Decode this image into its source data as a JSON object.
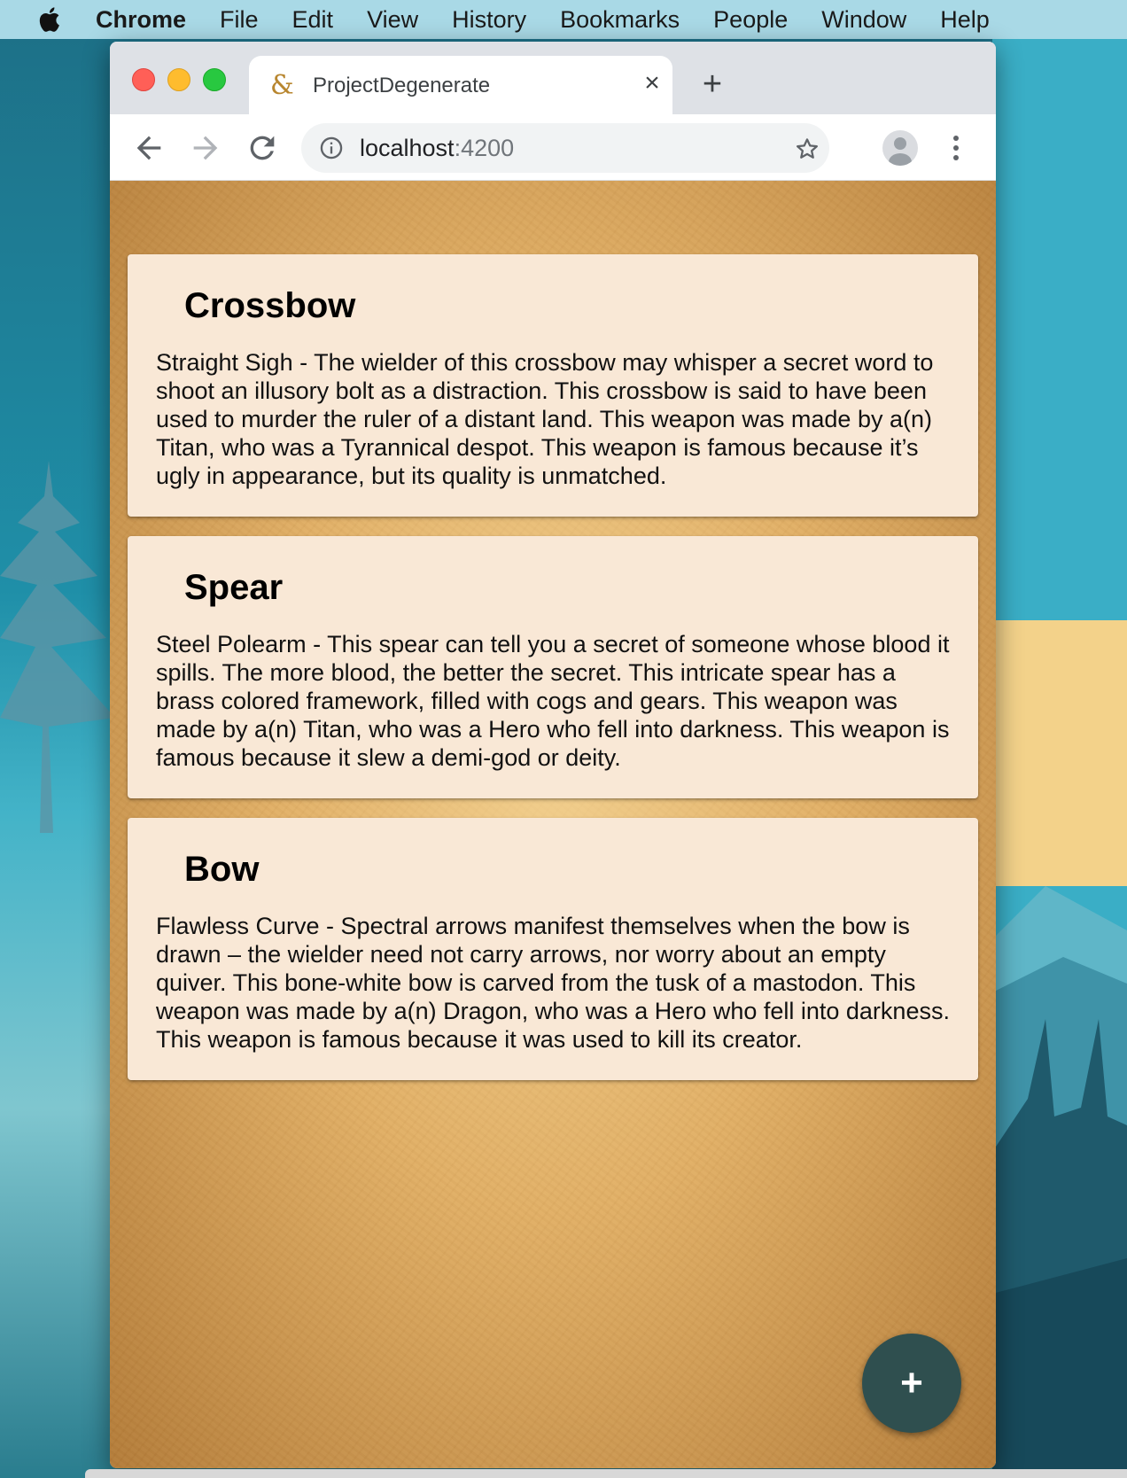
{
  "menubar": {
    "app": "Chrome",
    "items": [
      "File",
      "Edit",
      "View",
      "History",
      "Bookmarks",
      "People",
      "Window",
      "Help"
    ]
  },
  "browser": {
    "tab_title": "ProjectDegenerate",
    "tab_favicon": "&",
    "tab_close": "×",
    "new_tab": "+",
    "url_host": "localhost",
    "url_port": ":4200"
  },
  "cards": [
    {
      "title": "Crossbow",
      "text": "Straight Sigh - The wielder of this crossbow may whisper a secret word to shoot an illusory bolt as a distraction. This crossbow is said to have been used to murder the ruler of a distant land. This weapon was made by a(n) Titan, who was a Tyrannical despot. This weapon is famous because it’s ugly in appearance, but its quality is unmatched."
    },
    {
      "title": "Spear",
      "text": "Steel Polearm - This spear can tell you a secret of someone whose blood it spills. The more blood, the better the secret. This intricate spear has a brass colored framework, filled with cogs and gears. This weapon was made by a(n) Titan, who was a Hero who fell into darkness. This weapon is famous because it slew a demi-god or deity."
    },
    {
      "title": "Bow",
      "text": "Flawless Curve - Spectral arrows manifest themselves when the bow is drawn – the wielder need not carry arrows, nor worry about an empty quiver. This bone-white bow is carved from the tusk of a mastodon. This weapon was made by a(n) Dragon, who was a Hero who fell into darkness. This weapon is famous because it was used to kill its creator."
    }
  ],
  "fab": {
    "label": "+"
  }
}
